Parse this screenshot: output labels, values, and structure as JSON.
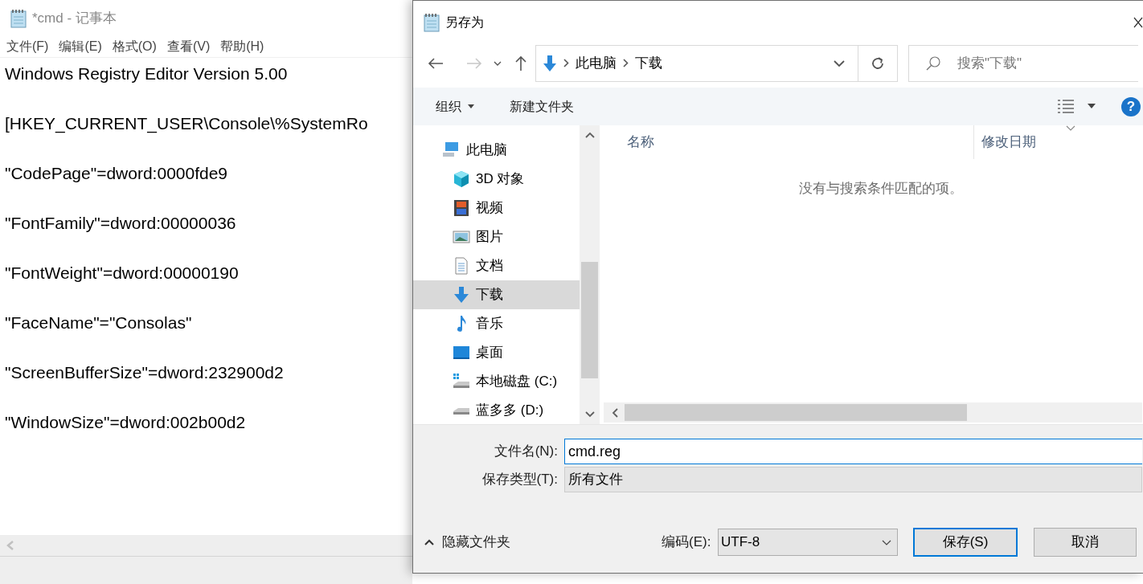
{
  "notepad": {
    "title": "*cmd - 记事本",
    "menu": [
      "文件(F)",
      "编辑(E)",
      "格式(O)",
      "查看(V)",
      "帮助(H)"
    ],
    "lines": [
      "Windows Registry Editor Version 5.00",
      "[HKEY_CURRENT_USER\\Console\\%SystemRo",
      "\"CodePage\"=dword:0000fde9",
      "\"FontFamily\"=dword:00000036",
      "\"FontWeight\"=dword:00000190",
      "\"FaceName\"=\"Consolas\"",
      "\"ScreenBufferSize\"=dword:232900d2",
      "\"WindowSize\"=dword:002b00d2"
    ]
  },
  "dialog": {
    "title": "另存为",
    "address": [
      "此电脑",
      "下载"
    ],
    "search": {
      "placeholder": "搜索\"下载\""
    },
    "toolbar": {
      "organize": "组织",
      "new_folder": "新建文件夹",
      "help": "?"
    },
    "nav": [
      {
        "label": "此电脑",
        "kind": "computer",
        "selected": false,
        "children": [
          {
            "label": "3D 对象",
            "kind": "cube",
            "selected": false
          },
          {
            "label": "视频",
            "kind": "film",
            "selected": false
          },
          {
            "label": "图片",
            "kind": "image",
            "selected": false
          },
          {
            "label": "文档",
            "kind": "document",
            "selected": false
          },
          {
            "label": "下载",
            "kind": "download",
            "selected": true
          },
          {
            "label": "音乐",
            "kind": "music",
            "selected": false
          },
          {
            "label": "桌面",
            "kind": "desktop",
            "selected": false
          },
          {
            "label": "本地磁盘 (C:)",
            "kind": "system-drive",
            "selected": false
          },
          {
            "label": "蓝多多 (D:)",
            "kind": "drive",
            "selected": false
          }
        ]
      }
    ],
    "columns": [
      "名称",
      "修改日期"
    ],
    "empty_message": "没有与搜索条件匹配的项。",
    "filename": {
      "label": "文件名(N):",
      "value": "cmd.reg"
    },
    "filetype": {
      "label": "保存类型(T):",
      "value": "所有文件"
    },
    "hide_folders": "隐藏文件夹",
    "encoding": {
      "label": "编码(E):",
      "value": "UTF-8"
    },
    "buttons": [
      {
        "label": "保存(S)",
        "default": true
      },
      {
        "label": "取消",
        "default": false
      }
    ]
  }
}
